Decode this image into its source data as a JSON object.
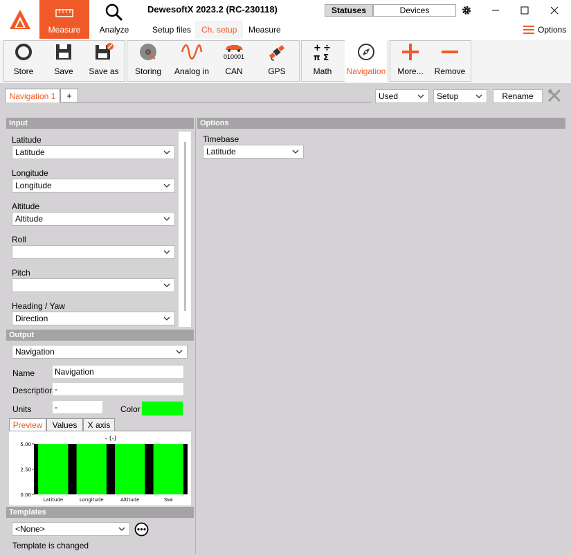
{
  "app": {
    "title": "DewesoftX 2023.2 (RC-230118)",
    "accent": "#f05a28"
  },
  "top_tabs": {
    "measure": "Measure",
    "analyze": "Analyze"
  },
  "segments": {
    "statuses": "Statuses",
    "devices": "Devices"
  },
  "sub_tabs": {
    "setup_files": "Setup files",
    "ch_setup": "Ch. setup",
    "measure": "Measure"
  },
  "options_label": "Options",
  "toolbar": {
    "store": "Store",
    "save": "Save",
    "save_as": "Save as",
    "storing": "Storing",
    "analog_in": "Analog in",
    "can": "CAN",
    "can_icon_text": "010001",
    "gps": "GPS",
    "math": "Math",
    "navigation": "Navigation",
    "more": "More...",
    "remove": "Remove"
  },
  "channel_tabs": {
    "active": "Navigation 1",
    "add": "+"
  },
  "filters": {
    "used": "Used",
    "setup": "Setup",
    "rename": "Rename"
  },
  "input": {
    "header": "Input",
    "fields": [
      {
        "label": "Latitude",
        "value": "Latitude"
      },
      {
        "label": "Longitude",
        "value": "Longitude"
      },
      {
        "label": "Altitude",
        "value": "Altitude"
      },
      {
        "label": "Roll",
        "value": ""
      },
      {
        "label": "Pitch",
        "value": ""
      },
      {
        "label": "Heading / Yaw",
        "value": "Direction"
      }
    ]
  },
  "options": {
    "header": "Options",
    "timebase_label": "Timebase",
    "timebase_value": "Latitude"
  },
  "output": {
    "header": "Output",
    "selected": "Navigation",
    "name_label": "Name",
    "name_value": "Navigation",
    "description_label": "Description",
    "description_value": "-",
    "units_label": "Units",
    "units_value": "-",
    "color_label": "Color",
    "color": "#00ff00"
  },
  "preview_tabs": {
    "preview": "Preview",
    "values": "Values",
    "xaxis": "X axis"
  },
  "templates": {
    "header": "Templates",
    "selected": "<None>",
    "status": "Template is changed"
  },
  "chart_data": {
    "type": "bar",
    "title": "- (-)",
    "categories": [
      "Latitude",
      "Longitude",
      "Altitude",
      "Yaw"
    ],
    "values": [
      5.0,
      5.0,
      5.0,
      5.0
    ],
    "yticks": [
      "5.00",
      "2.50",
      "0.00"
    ],
    "ylim": [
      0,
      5
    ],
    "bar_color": "#00ff00",
    "background": "#000000"
  }
}
